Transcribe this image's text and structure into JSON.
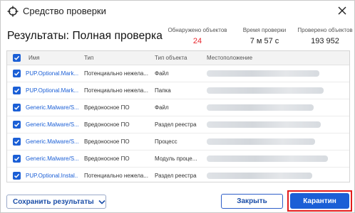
{
  "window": {
    "title": "Средство проверки"
  },
  "page": {
    "heading": "Результаты: Полная проверка"
  },
  "stats": {
    "detected_label": "Обнаружено объектов",
    "detected_value": "24",
    "time_label": "Время проверки",
    "time_value": "7 м 57 с",
    "scanned_label": "Проверено объектов",
    "scanned_value": "193 952"
  },
  "table": {
    "columns": {
      "name": "Имя",
      "type": "Тип",
      "object_type": "Тип объекта",
      "location": "Местоположение"
    },
    "rows": [
      {
        "name": "PUP.Optional.Mark...",
        "type": "Потенциально нежела...",
        "object_type": "Файл",
        "checked": true
      },
      {
        "name": "PUP.Optional.Mark...",
        "type": "Потенциально нежела...",
        "object_type": "Папка",
        "checked": true
      },
      {
        "name": "Generic.Malware/S...",
        "type": "Вредоносное ПО",
        "object_type": "Файл",
        "checked": true
      },
      {
        "name": "Generic.Malware/S...",
        "type": "Вредоносное ПО",
        "object_type": "Раздел реестра",
        "checked": true
      },
      {
        "name": "Generic.Malware/S...",
        "type": "Вредоносное ПО",
        "object_type": "Процесс",
        "checked": true
      },
      {
        "name": "Generic.Malware/S...",
        "type": "Вредоносное ПО",
        "object_type": "Модуль проце...",
        "checked": true
      },
      {
        "name": "PUP.Optional.Instal...",
        "type": "Потенциально нежела...",
        "object_type": "Раздел реестра",
        "checked": true
      }
    ]
  },
  "footer": {
    "save_label": "Сохранить результаты",
    "close_label": "Закрыть",
    "quarantine_label": "Карантин"
  },
  "colors": {
    "accent": "#1b5fd6",
    "alert": "#e8252b",
    "highlight_frame": "#e31d1d"
  },
  "icons": [
    "crosshair-icon",
    "close-icon",
    "checkbox-icon",
    "chevron-down-icon"
  ]
}
